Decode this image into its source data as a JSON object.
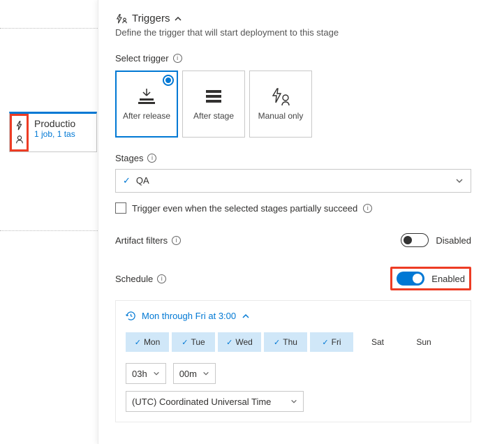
{
  "stage_card": {
    "title": "Productio",
    "subtitle": "1 job, 1 tas"
  },
  "panel": {
    "title": "Triggers",
    "subtitle": "Define the trigger that will start deployment to this stage"
  },
  "trigger_select": {
    "label": "Select trigger",
    "options": [
      {
        "label": "After release",
        "selected": true
      },
      {
        "label": "After stage",
        "selected": false
      },
      {
        "label": "Manual only",
        "selected": false
      }
    ]
  },
  "stages": {
    "label": "Stages",
    "selected": "QA",
    "checkbox_label": "Trigger even when the selected stages partially succeed"
  },
  "artifact_filters": {
    "label": "Artifact filters",
    "enabled": false,
    "state_label": "Disabled"
  },
  "schedule": {
    "label": "Schedule",
    "enabled": true,
    "state_label": "Enabled",
    "summary": "Mon through Fri at 3:00",
    "days": [
      {
        "label": "Mon",
        "selected": true
      },
      {
        "label": "Tue",
        "selected": true
      },
      {
        "label": "Wed",
        "selected": true
      },
      {
        "label": "Thu",
        "selected": true
      },
      {
        "label": "Fri",
        "selected": true
      },
      {
        "label": "Sat",
        "selected": false
      },
      {
        "label": "Sun",
        "selected": false
      }
    ],
    "hour": "03h",
    "minute": "00m",
    "timezone": "(UTC) Coordinated Universal Time"
  }
}
